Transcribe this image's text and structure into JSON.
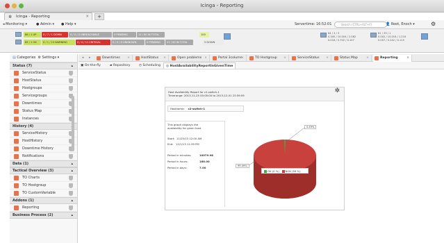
{
  "window": {
    "title": "Icinga - Reporting",
    "tab_label": "Icinga - Reporting",
    "tab_plus": "+"
  },
  "menu": {
    "monitoring": "Monitoring",
    "admin": "Admin",
    "help": "Help",
    "servertime": "Servertime: 16:52:01",
    "search_placeholder": "Search (CTRL+ALT+F)",
    "user": "Root, Enoch"
  },
  "status": {
    "hosts": [
      "86 / 1 UP",
      "0 / 7 / 1 DOWN",
      "0 / 0 / 0 UNREACHABLE",
      "0 PENDING",
      "11 / 80 IN TOTAL"
    ],
    "services": [
      "85 / 1 OK",
      "0 / 1 / 15 WARNING",
      "0 / 4 / 11 CRITICAL",
      "0 / 0 / 0 UNKNOWN",
      "0 PENDING",
      "21 / 80 IN TOTAL"
    ],
    "extra1": "100",
    "extra2": "5 DOWN",
    "stat_a": [
      "64 / 3 / 3",
      "0.300 / 10.004 / 2.082",
      "0.016 / 0.702 / 0.107"
    ],
    "stat_b": [
      "81 / 29 / 1",
      "0.002 / 10.016 / 1.216",
      "0.007 / 0.242 / 0.115"
    ]
  },
  "sidebar": {
    "header_categories": "Categories",
    "header_settings": "Settings",
    "sections": [
      {
        "title": "Status (7)",
        "items": [
          "ServiceStatus",
          "HostStatus",
          "Hostgroups",
          "Servicegroups",
          "Downtimes",
          "Status Map",
          "Instances"
        ]
      },
      {
        "title": "History (4)",
        "items": [
          "ServiceHistory",
          "HostHistory",
          "Downtime History",
          "Notifications"
        ]
      },
      {
        "title": "Data (1)",
        "items": []
      },
      {
        "title": "Tactical Overview (3)",
        "items": [
          "TO Charts",
          "TO Hostgroup",
          "TO CustomVariable"
        ]
      },
      {
        "title": "Addons (1)",
        "items": [
          "Reporting"
        ]
      },
      {
        "title": "Business Process (2)",
        "items": []
      }
    ]
  },
  "doc_tabs": [
    "Downtimes",
    "HostStatus",
    "Open problems",
    "Portal 3column",
    "TO Hostgroup",
    "ServiceStatus",
    "Status Map",
    "Reporting"
  ],
  "sub_tabs": [
    "On-the-fly",
    "Repository",
    "Scheduling",
    "HostAvailabilityReportInGivenTime"
  ],
  "report": {
    "title_line1": "Host Availability Report for c2-switch-1",
    "title_line2": "Timerange: 2013-11-25 00:00:00 to 2013-12-01 23:59:59",
    "hostname_label": "Hostname:",
    "hostname_value": "c2-switch-1",
    "desc": "This graph displays the availability for given host",
    "start_label": "Start:",
    "start_value": "11/25/13 12:00 AM",
    "end_label": "End:",
    "end_value": "12/1/13 11:59 PM",
    "pm_label": "Period in minutes:",
    "pm_value": "10079.98",
    "ph_label": "Period in hours:",
    "ph_value": "168.00",
    "pd_label": "Period in days:",
    "pd_value": "7.00",
    "pie_label_small": "0.49%",
    "pie_label_big": "99.49%",
    "legend_ok": "OK (0 %)",
    "legend_nok": "NOK (99 %)",
    "colors": {
      "ok": "#3fae3f",
      "nok": "#c9413c"
    }
  }
}
